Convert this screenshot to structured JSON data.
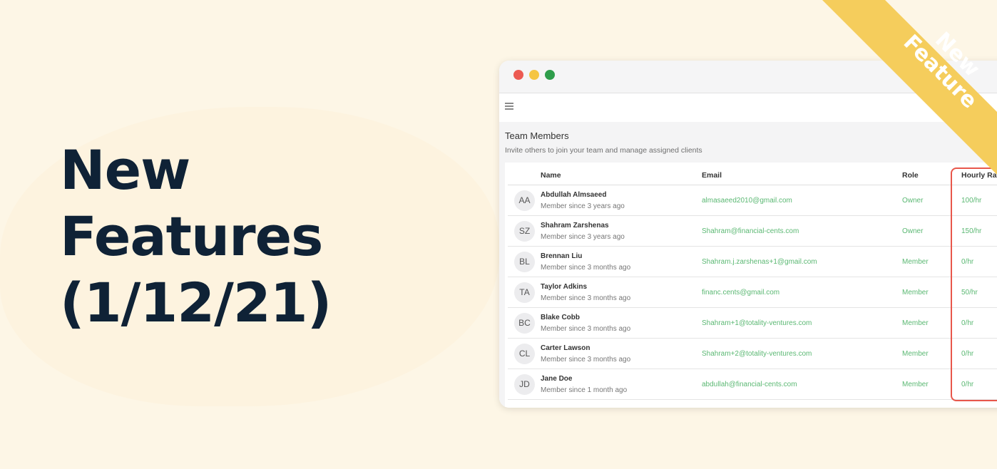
{
  "headline": {
    "line1": "New",
    "line2": "Features",
    "line3": "(1/12/21)"
  },
  "ribbon": {
    "line1": "New",
    "line2": "Feature"
  },
  "page": {
    "title": "Team Members",
    "subtitle": "Invite others to join your team and manage assigned clients"
  },
  "table": {
    "headers": {
      "name": "Name",
      "email": "Email",
      "role": "Role",
      "rate": "Hourly Rate"
    },
    "rows": [
      {
        "initials": "AA",
        "name": "Abdullah Almsaeed",
        "since": "Member since 3 years ago",
        "email": "almasaeed2010@gmail.com",
        "role": "Owner",
        "rate": "100/hr"
      },
      {
        "initials": "SZ",
        "name": "Shahram Zarshenas",
        "since": "Member since 3 years ago",
        "email": "Shahram@financial-cents.com",
        "role": "Owner",
        "rate": "150/hr"
      },
      {
        "initials": "BL",
        "name": "Brennan Liu",
        "since": "Member since 3 months ago",
        "email": "Shahram.j.zarshenas+1@gmail.com",
        "role": "Member",
        "rate": "0/hr"
      },
      {
        "initials": "TA",
        "name": "Taylor Adkins",
        "since": "Member since 3 months ago",
        "email": "financ.cents@gmail.com",
        "role": "Member",
        "rate": "50/hr"
      },
      {
        "initials": "BC",
        "name": "Blake Cobb",
        "since": "Member since 3 months ago",
        "email": "Shahram+1@totality-ventures.com",
        "role": "Member",
        "rate": "0/hr"
      },
      {
        "initials": "CL",
        "name": "Carter Lawson",
        "since": "Member since 3 months ago",
        "email": "Shahram+2@totality-ventures.com",
        "role": "Member",
        "rate": "0/hr"
      },
      {
        "initials": "JD",
        "name": "Jane Doe",
        "since": "Member since 1 month ago",
        "email": "abdullah@financial-cents.com",
        "role": "Member",
        "rate": "0/hr"
      }
    ]
  },
  "colors": {
    "accent": "#5bb873",
    "highlight": "#e8574b",
    "ribbon": "#f5cd5c",
    "headline": "#0f2236"
  },
  "icons": {
    "menu": "hamburger-icon"
  }
}
